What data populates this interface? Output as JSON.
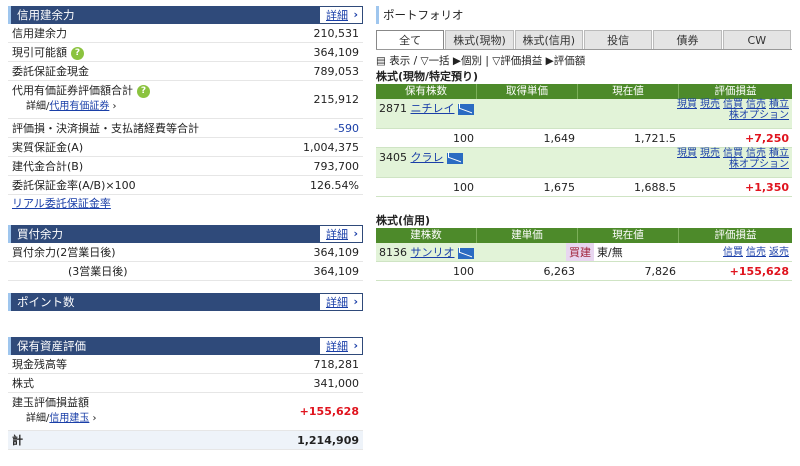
{
  "left": {
    "credit": {
      "title": "信用建余力",
      "more": "詳細",
      "rows": [
        {
          "label": "信用建余力",
          "value": "210,531"
        },
        {
          "label": "現引可能額",
          "value": "364,109"
        },
        {
          "label": "委託保証金現金",
          "value": "789,053"
        },
        {
          "label": "代用有価証券評価額合計",
          "value": "215,912",
          "sub_prefix": "詳細/",
          "sub_link": "代用有価証券"
        },
        {
          "label": "評価損・決済損益・支払諸経費等合計",
          "value": "-590"
        },
        {
          "label": "実質保証金(A)",
          "value": "1,004,375"
        },
        {
          "label": "建代金合計(B)",
          "value": "793,700"
        },
        {
          "label": "委託保証金率(A/B)×100",
          "value": "126.54%"
        }
      ],
      "link": "リアル委託保証金率"
    },
    "buying": {
      "title": "買付余力",
      "more": "詳細",
      "rows": [
        {
          "label": "買付余力(2営業日後)",
          "value": "364,109"
        },
        {
          "label": "(3営業日後)",
          "value": "364,109"
        }
      ]
    },
    "points": {
      "title": "ポイント数",
      "more": "詳細"
    },
    "assets": {
      "title": "保有資産評価",
      "more": "詳細",
      "rows": [
        {
          "label": "現金残高等",
          "value": "718,281"
        },
        {
          "label": "株式",
          "value": "341,000"
        },
        {
          "label": "建玉評価損益額",
          "value": "+155,628",
          "sub_prefix": "詳細/",
          "sub_link": "信用建玉"
        },
        {
          "label": "計",
          "value": "1,214,909"
        }
      ]
    }
  },
  "right": {
    "title": "ポートフォリオ",
    "tabs": [
      "全て",
      "株式(現物)",
      "株式(信用)",
      "投信",
      "債券",
      "CW"
    ],
    "filters": {
      "display": "表示",
      "all": "一括",
      "each": "個別",
      "pl": "評価損益",
      "val": "評価額"
    },
    "spot": {
      "title": "株式(現物/特定預り)",
      "headers": [
        "保有株数",
        "取得単価",
        "現在値",
        "評価損益"
      ],
      "links1": [
        "現買",
        "現売",
        "信買",
        "信売",
        "積立"
      ],
      "links2": "株オプション",
      "rows": [
        {
          "code": "2871",
          "name": "ニチレイ",
          "qty": "100",
          "cost": "1,649",
          "price": "1,721.5",
          "pl": "+7,250"
        },
        {
          "code": "3405",
          "name": "クラレ",
          "qty": "100",
          "cost": "1,675",
          "price": "1,688.5",
          "pl": "+1,350"
        }
      ]
    },
    "margin": {
      "title": "株式(信用)",
      "headers": [
        "建株数",
        "建単価",
        "現在値",
        "評価損益"
      ],
      "links": [
        "信買",
        "信売",
        "返売"
      ],
      "rows": [
        {
          "code": "8136",
          "name": "サンリオ",
          "side": "買建",
          "market": "東/無",
          "qty": "100",
          "cost": "6,263",
          "price": "7,826",
          "pl": "+155,628"
        }
      ]
    }
  }
}
